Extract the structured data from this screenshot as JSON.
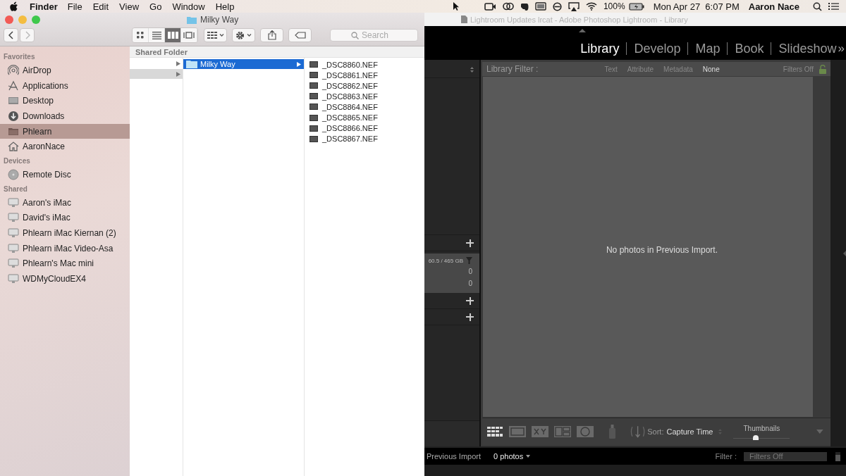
{
  "menubar": {
    "app": "Finder",
    "menus": [
      "File",
      "Edit",
      "View",
      "Go",
      "Window",
      "Help"
    ],
    "battery": "100%",
    "clock": "Mon Apr 27  6:07 PM",
    "user": "Aaron Nace"
  },
  "finder": {
    "title": "Milky Way",
    "view_modes": [
      {
        "selected": false
      },
      {
        "selected": false
      },
      {
        "selected": true
      },
      {
        "selected": false
      }
    ],
    "search": {
      "placeholder": "Search"
    },
    "path_header": "Shared Folder",
    "sidebar": [
      {
        "heading": "Favorites",
        "items": [
          {
            "label": "AirDrop",
            "kind": "airdrop",
            "selected": false
          },
          {
            "label": "Applications",
            "kind": "apps",
            "selected": false
          },
          {
            "label": "Desktop",
            "kind": "desktop",
            "selected": false
          },
          {
            "label": "Downloads",
            "kind": "download",
            "selected": false
          },
          {
            "label": "Phlearn",
            "kind": "folder",
            "selected": true
          },
          {
            "label": "AaronNace",
            "kind": "home",
            "selected": false
          }
        ]
      },
      {
        "heading": "Devices",
        "items": [
          {
            "label": "Remote Disc",
            "kind": "disc",
            "selected": false
          }
        ]
      },
      {
        "heading": "Shared",
        "items": [
          {
            "label": "Aaron's iMac",
            "kind": "computer",
            "selected": false
          },
          {
            "label": "David's iMac",
            "kind": "computer",
            "selected": false
          },
          {
            "label": "Phlearn iMac Kiernan (2)",
            "kind": "computer",
            "selected": false
          },
          {
            "label": "Phlearn iMac Video-Asa",
            "kind": "computer",
            "selected": false
          },
          {
            "label": "Phlearn's Mac mini",
            "kind": "computer",
            "selected": false
          },
          {
            "label": "WDMyCloudEX4",
            "kind": "computer",
            "selected": false
          }
        ]
      }
    ],
    "column_1": [
      {
        "selected": false
      },
      {
        "selected": true
      }
    ],
    "column_2": [
      {
        "label": "Milky Way",
        "selected": true
      }
    ],
    "column_3": [
      "_DSC8860.NEF",
      "_DSC8861.NEF",
      "_DSC8862.NEF",
      "_DSC8863.NEF",
      "_DSC8864.NEF",
      "_DSC8865.NEF",
      "_DSC8866.NEF",
      "_DSC8867.NEF"
    ]
  },
  "lightroom": {
    "window_title": "Lightroom Updates lrcat - Adobe Photoshop Lightroom - Library",
    "modules": [
      {
        "label": "Library",
        "selected": true
      },
      {
        "label": "Develop",
        "selected": false
      },
      {
        "label": "Map",
        "selected": false
      },
      {
        "label": "Book",
        "selected": false
      },
      {
        "label": "Slideshow",
        "selected": false
      }
    ],
    "modules_more": "»",
    "left_panel": {
      "disk": "60.5 / 465 GB",
      "counts": [
        "0",
        "0"
      ]
    },
    "filter_bar": {
      "label": "Library Filter :",
      "options": [
        {
          "label": "Text",
          "selected": false
        },
        {
          "label": "Attribute",
          "selected": false
        },
        {
          "label": "Metadata",
          "selected": false
        },
        {
          "label": "None",
          "selected": true
        }
      ],
      "status": "Filters Off"
    },
    "empty_message": "No photos in Previous Import.",
    "toolbar": {
      "sort_label": "Sort:",
      "sort_value": "Capture Time",
      "thumbnails_label": "Thumbnails",
      "thumbnails": {
        "level": 0.4
      }
    },
    "filmstrip": {
      "source": "Previous Import",
      "count": "0 photos",
      "filter_label": "Filter :",
      "filter_value": "Filters Off"
    }
  }
}
